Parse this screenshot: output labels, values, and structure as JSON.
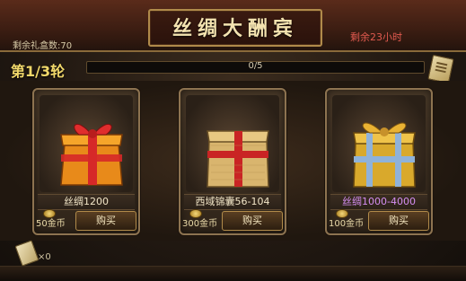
{
  "header": {
    "title": "丝绸大酬宾",
    "remaining_boxes": "剩余礼盒数:70",
    "timer": "剩余23小时"
  },
  "round": {
    "label": "第1/3轮",
    "progress_text": "0/5",
    "progress_fraction": 0.0
  },
  "cards": [
    {
      "name": "丝绸1200",
      "price": "50金币",
      "buy_label": "购买",
      "name_color": "#f2e6c8",
      "gift_color": "orange-red-ribbon"
    },
    {
      "name": "西域锦囊56-104",
      "price": "300金币",
      "buy_label": "购买",
      "name_color": "#f2e6c8",
      "gift_color": "tan-red-ribbon"
    },
    {
      "name": "丝绸1000-4000",
      "price": "100金币",
      "buy_label": "购买",
      "name_color": "#d48ef1",
      "gift_color": "gold-blue-ribbon"
    }
  ],
  "footer": {
    "item_count": "×0"
  },
  "colors": {
    "accent_gold": "#f0d76a",
    "timer_red": "#e15a4f",
    "rare_purple": "#d48ef1"
  }
}
